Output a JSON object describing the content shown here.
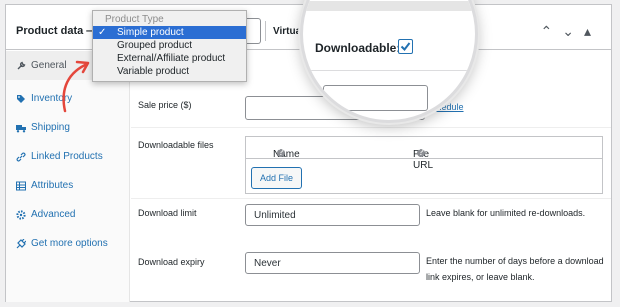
{
  "header": {
    "title": "Product data —",
    "virtual_label": "Virtual:"
  },
  "product_type_dropdown": {
    "title": "Product Type",
    "options": [
      "Simple product",
      "Grouped product",
      "External/Affiliate product",
      "Variable product"
    ],
    "selected": "Simple product",
    "check_glyph": "✓"
  },
  "sidebar": {
    "items": [
      {
        "label": "General",
        "icon": "wrench-icon"
      },
      {
        "label": "Inventory",
        "icon": "tag-icon"
      },
      {
        "label": "Shipping",
        "icon": "truck-icon"
      },
      {
        "label": "Linked Products",
        "icon": "link-icon"
      },
      {
        "label": "Attributes",
        "icon": "table-icon"
      },
      {
        "label": "Advanced",
        "icon": "gear-icon"
      },
      {
        "label": "Get more options",
        "icon": "plugin-icon"
      }
    ]
  },
  "general": {
    "sale_price_label": "Sale price ($)",
    "schedule_link": "Schedule",
    "downloadable_files_label": "Downloadable files",
    "col_name": "Name",
    "col_file_url": "File URL",
    "add_file": "Add File",
    "download_limit_label": "Download limit",
    "download_limit_value": "Unlimited",
    "download_limit_help": "Leave blank for unlimited re-downloads.",
    "download_expiry_label": "Download expiry",
    "download_expiry_value": "Never",
    "download_expiry_help": "Enter the number of days before a download link expires, or leave blank."
  },
  "magnifier": {
    "downloadable_label": "Downloadable:",
    "downloadable_checked": true,
    "check_glyph": "✓"
  },
  "colors": {
    "accent": "#2271b1",
    "selected_option": "#2b6ed3",
    "arrow": "#e4473c"
  }
}
